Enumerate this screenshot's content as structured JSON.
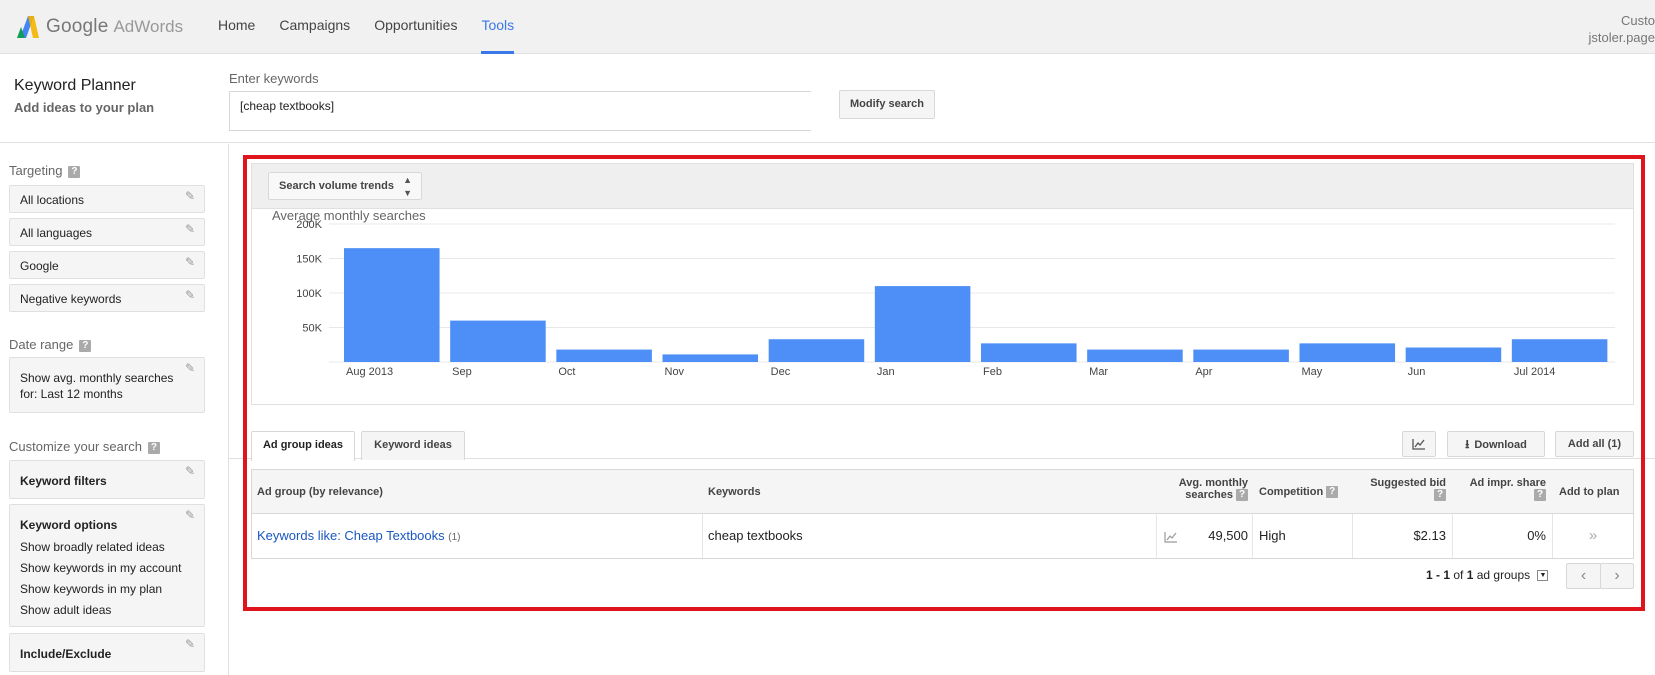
{
  "topbar": {
    "brand_google": "Google",
    "brand_adwords": "AdWords",
    "nav": [
      "Home",
      "Campaigns",
      "Opportunities",
      "Tools"
    ],
    "active_nav": "Tools",
    "account_line1": "Custo",
    "account_line2": "jstoler.page"
  },
  "header": {
    "title": "Keyword Planner",
    "subtitle": "Add ideas to your plan",
    "enter_label": "Enter keywords",
    "keyword_value": "[cheap textbooks]",
    "modify_button": "Modify search"
  },
  "sidebar": {
    "targeting_heading": "Targeting",
    "targeting_items": [
      "All locations",
      "All languages",
      "Google",
      "Negative keywords"
    ],
    "date_heading": "Date range",
    "date_line1": "Show avg. monthly searches",
    "date_line2": "for: Last 12 months",
    "customize_heading": "Customize your search",
    "keyword_filters": "Keyword filters",
    "keyword_options": "Keyword options",
    "options": [
      "Show broadly related ideas",
      "Show keywords in my account",
      "Show keywords in my plan",
      "Show adult ideas"
    ],
    "include_exclude": "Include/Exclude"
  },
  "chart_panel": {
    "select_label": "Search volume trends"
  },
  "chart_data": {
    "type": "bar",
    "title": "Average monthly searches",
    "categories": [
      "Aug 2013",
      "Sep",
      "Oct",
      "Nov",
      "Dec",
      "Jan",
      "Feb",
      "Mar",
      "Apr",
      "May",
      "Jun",
      "Jul 2014"
    ],
    "values": [
      165000,
      60000,
      18000,
      11000,
      33000,
      110000,
      27000,
      18000,
      18000,
      27000,
      21000,
      33000
    ],
    "yticks": [
      "200K",
      "150K",
      "100K",
      "50K"
    ],
    "ytick_values": [
      200000,
      150000,
      100000,
      50000
    ],
    "ylim": [
      0,
      200000
    ],
    "bar_color": "#4d8ff7",
    "grid": true
  },
  "tabs": {
    "ad_group_ideas": "Ad group ideas",
    "keyword_ideas": "Keyword ideas",
    "download": "Download",
    "add_all": "Add all (1)"
  },
  "table": {
    "headers": {
      "ad_group": "Ad group (by relevance)",
      "keywords": "Keywords",
      "avg_monthly_line1": "Avg. monthly",
      "avg_monthly_line2": "searches",
      "competition": "Competition",
      "suggested_bid": "Suggested bid",
      "ad_impr_share": "Ad impr. share",
      "add_to_plan": "Add to plan"
    },
    "rows": [
      {
        "ad_group": "Keywords like: Cheap Textbooks",
        "count": "(1)",
        "keywords": "cheap textbooks",
        "avg_monthly": "49,500",
        "competition": "High",
        "suggested_bid": "$2.13",
        "ad_impr_share": "0%"
      }
    ]
  },
  "pagination": {
    "range": "1 - 1",
    "of": "of",
    "total": "1",
    "unit": "ad groups"
  }
}
